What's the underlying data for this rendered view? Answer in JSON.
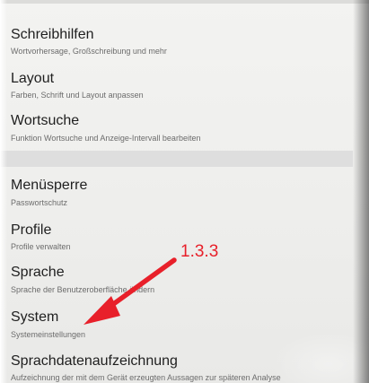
{
  "settings": {
    "items": [
      {
        "title": "Schreibhilfen",
        "subtitle": "Wortvorhersage, Großschreibung und mehr"
      },
      {
        "title": "Layout",
        "subtitle": "Farben, Schrift und Layout anpassen"
      },
      {
        "title": "Wortsuche",
        "subtitle": "Funktion Wortsuche und Anzeige-Intervall bearbeiten"
      },
      {
        "title": "Menüsperre",
        "subtitle": "Passwortschutz"
      },
      {
        "title": "Profile",
        "subtitle": "Profile verwalten"
      },
      {
        "title": "Sprache",
        "subtitle": "Sprache der Benutzeroberfläche ändern"
      },
      {
        "title": "System",
        "subtitle": "Systemeinstellungen"
      },
      {
        "title": "Sprachdatenaufzeichnung",
        "subtitle": "Aufzeichnung der mit dem Gerät erzeugten Aussagen zur späteren Analyse"
      }
    ]
  },
  "annotation": {
    "label": "1.3.3",
    "color": "#e8202a",
    "points_to": "System"
  }
}
